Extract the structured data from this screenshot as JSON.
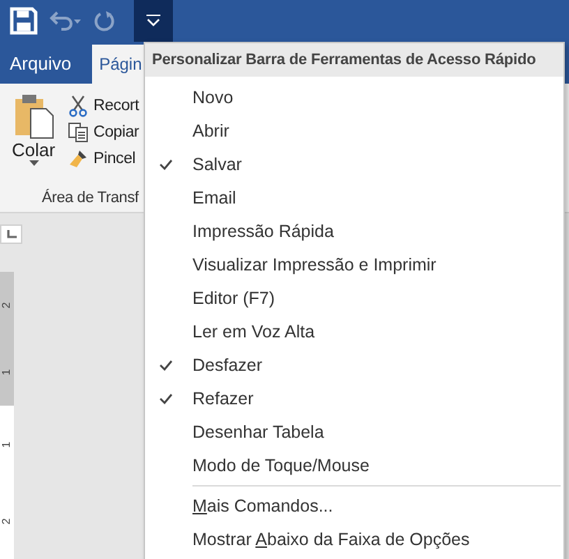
{
  "quick_access": {
    "undo_enabled": false,
    "redo_enabled": false,
    "menu_open": true
  },
  "tabs": [
    {
      "label": "Arquivo",
      "kind": "file",
      "selected": false
    },
    {
      "label": "Págin",
      "kind": "tab",
      "selected": true
    }
  ],
  "clipboard_group": {
    "paste_label": "Colar",
    "commands": [
      {
        "label": "Recort",
        "kind": "cut"
      },
      {
        "label": "Copiar",
        "kind": "copy"
      },
      {
        "label": "Pincel",
        "kind": "brush"
      }
    ],
    "group_label": "Área de Transf"
  },
  "ruler_labels": [
    "2",
    "1",
    "1",
    "2"
  ],
  "menu": {
    "title": "Personalizar Barra de Ferramentas de Acesso Rápido",
    "items": [
      {
        "label": "Novo",
        "checked": false
      },
      {
        "label": "Abrir",
        "checked": false
      },
      {
        "label": "Salvar",
        "checked": true
      },
      {
        "label": "Email",
        "checked": false
      },
      {
        "label": "Impressão Rápida",
        "checked": false
      },
      {
        "label": "Visualizar Impressão e Imprimir",
        "checked": false
      },
      {
        "label": "Editor (F7)",
        "checked": false
      },
      {
        "label": "Ler em Voz Alta",
        "checked": false
      },
      {
        "label": "Desfazer",
        "checked": true
      },
      {
        "label": "Refazer",
        "checked": true
      },
      {
        "label": "Desenhar Tabela",
        "checked": false
      },
      {
        "label": "Modo de Toque/Mouse",
        "checked": false
      }
    ],
    "commands": [
      {
        "access_key": "M",
        "label_end": "ais Comandos..."
      },
      {
        "label_start": "Mostrar ",
        "access_key": "A",
        "label_end": "baixo da Faixa de Opções"
      }
    ]
  }
}
